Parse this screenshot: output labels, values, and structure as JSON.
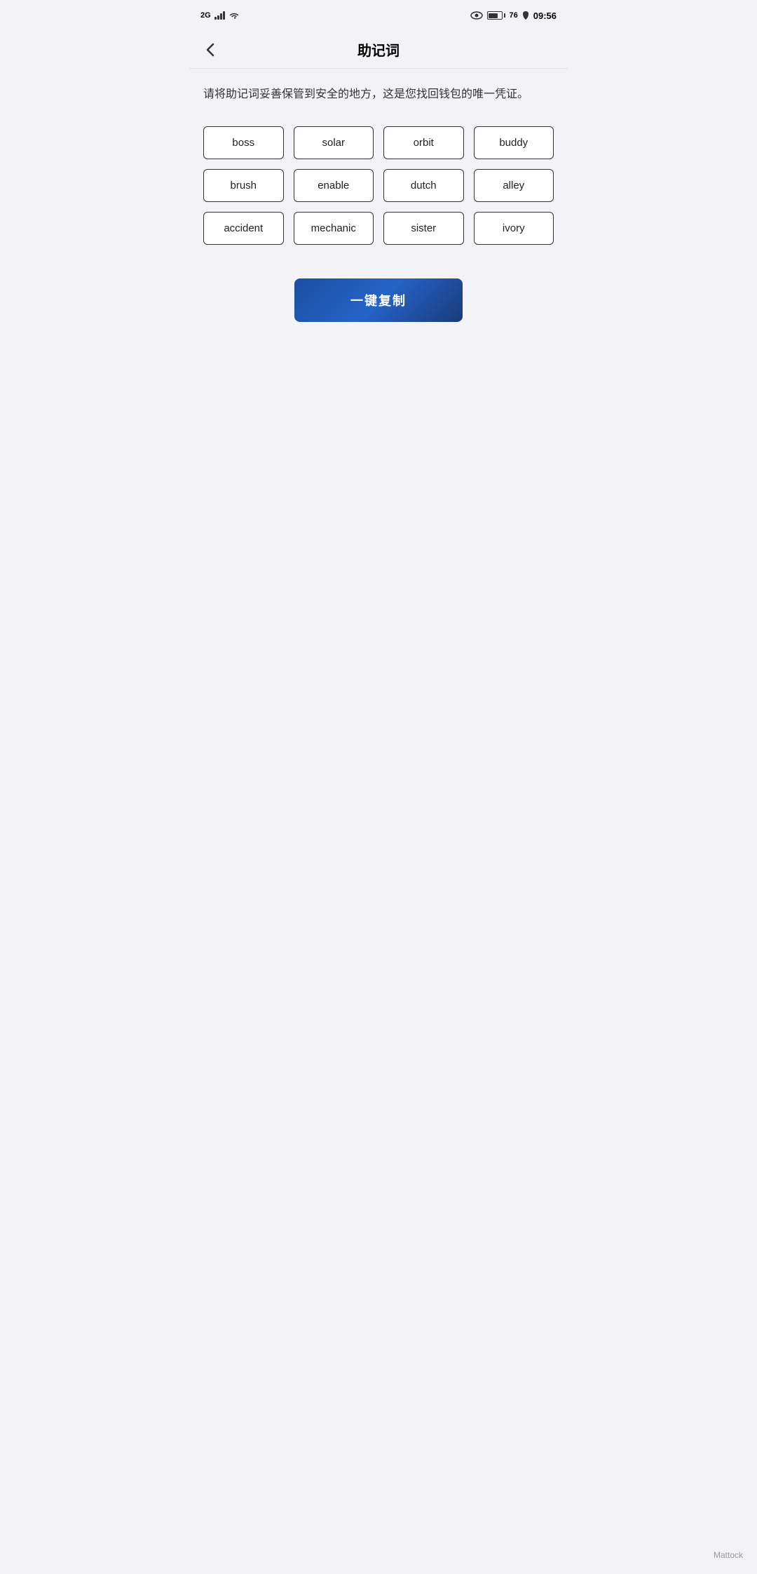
{
  "statusBar": {
    "signal": "2G",
    "time": "09:56",
    "batteryPercent": 76
  },
  "header": {
    "title": "助记词",
    "backLabel": "‹"
  },
  "description": "请将助记词妥善保管到安全的地方，这是您找回钱包的唯一凭证。",
  "mnemonicWords": [
    "boss",
    "solar",
    "orbit",
    "buddy",
    "brush",
    "enable",
    "dutch",
    "alley",
    "accident",
    "mechanic",
    "sister",
    "ivory"
  ],
  "copyButton": {
    "label": "一键复制"
  },
  "watermark": "Mattock"
}
